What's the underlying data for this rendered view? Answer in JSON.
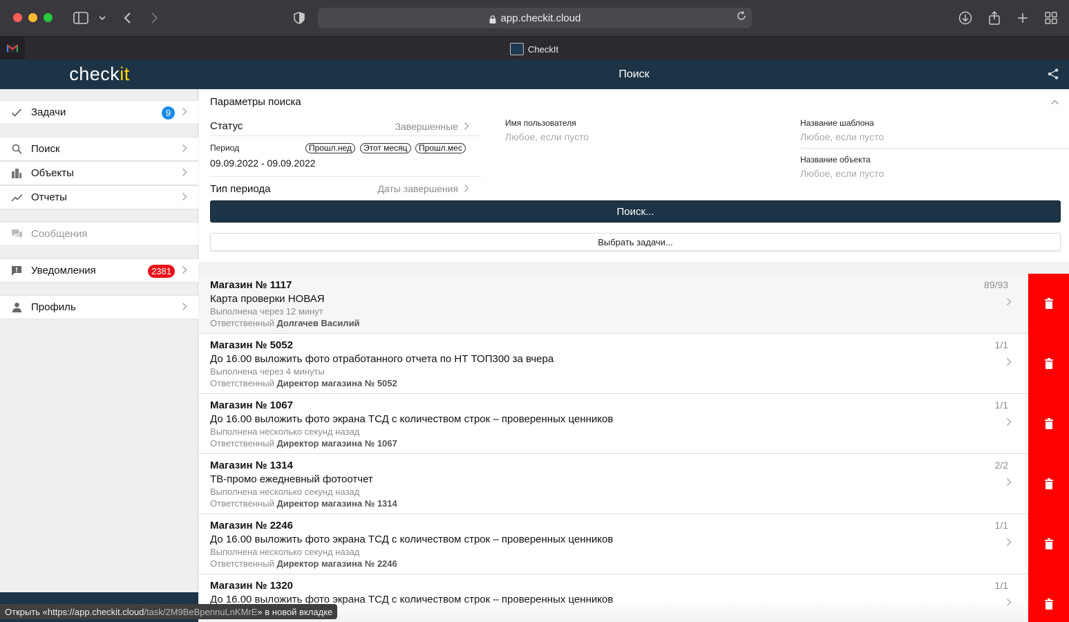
{
  "browser": {
    "url": "app.checkit.cloud",
    "tab_title": "CheckIt"
  },
  "app": {
    "brand_prefix": "check",
    "brand_suffix": "it",
    "header_title": "Поиск"
  },
  "sidebar": {
    "items": [
      {
        "label": "Задачи",
        "badge": "9"
      },
      {
        "label": "Поиск"
      },
      {
        "label": "Объекты"
      },
      {
        "label": "Отчеты"
      },
      {
        "label": "Сообщения"
      },
      {
        "label": "Уведомления",
        "badge": "2381"
      },
      {
        "label": "Профиль"
      }
    ]
  },
  "search_params": {
    "title": "Параметры поиска",
    "status_label": "Статус",
    "status_value": "Завершенные",
    "period_label": "Период",
    "period_pills": [
      "Прошл.нед",
      "Этот месяц",
      "Прошл.мес"
    ],
    "period_value": "09.09.2022 - 09.09.2022",
    "period_type_label": "Тип периода",
    "period_type_value": "Даты завершения",
    "user_label": "Имя пользователя",
    "user_placeholder": "Любое, если пусто",
    "template_label": "Название шаблона",
    "template_placeholder": "Любое, если пусто",
    "object_label": "Название объекта",
    "object_placeholder": "Любое, если пусто",
    "search_button": "Поиск...",
    "choose_button": "Выбрать задачи..."
  },
  "results": [
    {
      "store": "Магазин № 1117",
      "task": "Карта проверки НОВАЯ",
      "status": "Выполнена через 12 минут",
      "resp_label": "Ответственный",
      "resp_name": "Долгачев Василий",
      "count": "89/93"
    },
    {
      "store": "Магазин № 5052",
      "task": "До 16.00 выложить фото отработанного отчета по НТ ТОП300 за вчера",
      "status": "Выполнена через 4 минуты",
      "resp_label": "Ответственный",
      "resp_name": "Директор магазина № 5052",
      "count": "1/1"
    },
    {
      "store": "Магазин № 1067",
      "task": "До 16.00 выложить фото экрана ТСД с количеством строк – проверенных ценников",
      "status": "Выполнена несколько секунд назад",
      "resp_label": "Ответственный",
      "resp_name": "Директор магазина № 1067",
      "count": "1/1"
    },
    {
      "store": "Магазин № 1314",
      "task": "ТВ-промо ежедневный фотоотчет",
      "status": "Выполнена несколько секунд назад",
      "resp_label": "Ответственный",
      "resp_name": "Директор магазина № 1314",
      "count": "2/2"
    },
    {
      "store": "Магазин № 2246",
      "task": "До 16.00 выложить фото экрана ТСД с количеством строк – проверенных ценников",
      "status": "Выполнена несколько секунд назад",
      "resp_label": "Ответственный",
      "resp_name": "Директор магазина № 2246",
      "count": "1/1"
    },
    {
      "store": "Магазин № 1320",
      "task": "До 16.00 выложить фото экрана ТСД с количеством строк – проверенных ценников",
      "status": "",
      "resp_label": "",
      "resp_name": "",
      "count": "1/1"
    }
  ],
  "status_tooltip": {
    "prefix": "Открыть «https://app.checkit.cloud",
    "path": "/task/2M9BeBpennuLnKMrE",
    "suffix": "» в новой вкладке"
  },
  "colors": {
    "header": "#1d3446",
    "brand_accent": "#ffd500",
    "delete": "#ff0000",
    "badge_blue": "#1a8ce8",
    "badge_red": "#e8131a"
  }
}
